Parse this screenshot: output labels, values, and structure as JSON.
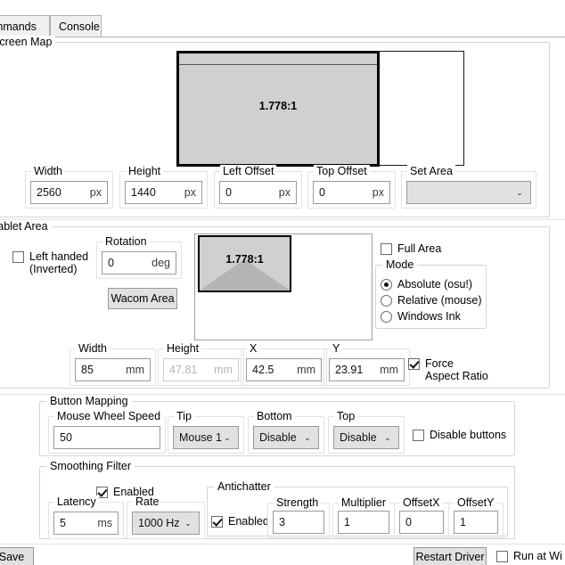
{
  "window": {
    "tabs": [
      {
        "label": "ommands",
        "active": false
      },
      {
        "label": "Console",
        "active": false
      }
    ]
  },
  "screen_map": {
    "group_label": "Screen Map",
    "diagram": {
      "ratio_label": "1.778:1",
      "monitor_fill": "#d0d0d0",
      "monitor_border": "#000000",
      "outline_border": "#1b1b1b"
    },
    "fields": [
      {
        "name": "width",
        "label": "Width",
        "value": "2560",
        "unit": "px",
        "disabled": false
      },
      {
        "name": "height",
        "label": "Height",
        "value": "1440",
        "unit": "px",
        "disabled": false
      },
      {
        "name": "left_offset",
        "label": "Left Offset",
        "value": "0",
        "unit": "px",
        "disabled": false
      },
      {
        "name": "top_offset",
        "label": "Top Offset",
        "value": "0",
        "unit": "px",
        "disabled": false
      }
    ],
    "set_area": {
      "label": "Set Area",
      "value": "",
      "arrow": "⌄"
    }
  },
  "tablet_area": {
    "group_label": "Tablet Area",
    "left_handed": {
      "line1": "Left handed",
      "line2": "(Inverted)",
      "checked": false
    },
    "rotation": {
      "label": "Rotation",
      "value": "0",
      "unit": "deg"
    },
    "wacom_area_button": "Wacom Area",
    "diagram": {
      "ratio_label": "1.778:1"
    },
    "full_area": {
      "label": "Full Area",
      "checked": false
    },
    "mode": {
      "label": "Mode",
      "options": [
        {
          "label": "Absolute (osu!)",
          "selected": true
        },
        {
          "label": "Relative (mouse)",
          "selected": false
        },
        {
          "label": "Windows Ink",
          "selected": false
        }
      ]
    },
    "fields": [
      {
        "name": "width",
        "label": "Width",
        "value": "85",
        "unit": "mm",
        "disabled": false
      },
      {
        "name": "height",
        "label": "Height",
        "value": "47.81",
        "unit": "mm",
        "disabled": true
      },
      {
        "name": "x",
        "label": "X",
        "value": "42.5",
        "unit": "mm",
        "disabled": false
      },
      {
        "name": "y",
        "label": "Y",
        "value": "23.91",
        "unit": "mm",
        "disabled": false
      }
    ],
    "force_aspect_ratio": {
      "line1": "Force",
      "line2": "Aspect Ratio",
      "checked": true
    }
  },
  "button_mapping": {
    "group_label": "Button Mapping",
    "mouse_wheel_speed": {
      "label": "Mouse Wheel Speed",
      "value": "50"
    },
    "tip": {
      "label": "Tip",
      "value": "Mouse 1",
      "arrow": "⌄"
    },
    "bottom": {
      "label": "Bottom",
      "value": "Disable",
      "arrow": "⌄"
    },
    "top": {
      "label": "Top",
      "value": "Disable",
      "arrow": "⌄"
    },
    "disable_buttons": {
      "label": "Disable buttons",
      "checked": false
    }
  },
  "smoothing_filter": {
    "group_label": "Smoothing Filter",
    "enabled": {
      "label": "Enabled",
      "checked": true
    },
    "latency": {
      "label": "Latency",
      "value": "5",
      "unit": "ms"
    },
    "rate": {
      "label": "Rate",
      "value": "1000 Hz",
      "arrow": "⌄"
    },
    "antichatter": {
      "group_label": "Antichatter",
      "enabled": {
        "label": "Enabled",
        "checked": true
      },
      "strength": {
        "label": "Strength",
        "value": "3"
      },
      "multiplier": {
        "label": "Multiplier",
        "value": "1"
      },
      "offset_x": {
        "label": "OffsetX",
        "value": "0"
      },
      "offset_y": {
        "label": "OffsetY",
        "value": "1"
      }
    }
  },
  "footer": {
    "save_button": "Save",
    "restart_driver_button": "Restart Driver",
    "run_at_windows": {
      "label": "Run at Wi",
      "checked": false
    }
  }
}
